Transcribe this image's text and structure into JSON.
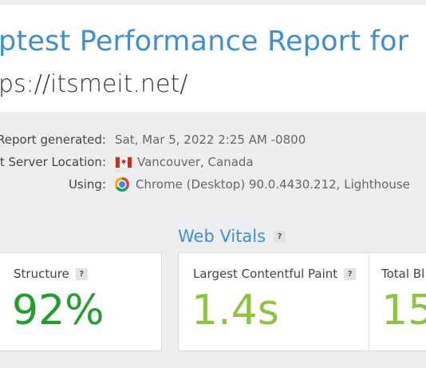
{
  "report": {
    "title": "ptest Performance Report for",
    "url": "ps://itsmeit.net/"
  },
  "meta": {
    "generated_label": "Report generated:",
    "generated_value": "Sat, Mar 5, 2022 2:25 AM -0800",
    "location_label": "t Server Location:",
    "location_value": "Vancouver, Canada",
    "using_label": "Using:",
    "using_value": "Chrome (Desktop) 90.0.4430.212, Lighthouse"
  },
  "web_vitals": {
    "title": "Web Vitals",
    "help": "?",
    "structure_label": "Structure",
    "structure_value": "92%",
    "lcp_label": "Largest Contentful Paint",
    "lcp_value": "1.4s",
    "tbt_label": "Total Bl",
    "tbt_value": "15"
  },
  "colors": {
    "accent_blue": "#3c8fd8",
    "grade_green": "#1fa02a",
    "metric_green": "#8cc43c"
  }
}
